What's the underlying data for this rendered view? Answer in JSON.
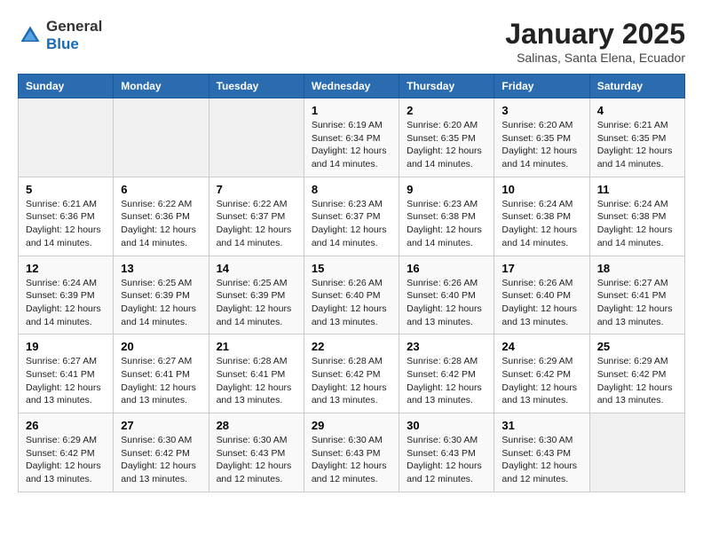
{
  "header": {
    "logo": {
      "general": "General",
      "blue": "Blue"
    },
    "title": "January 2025",
    "subtitle": "Salinas, Santa Elena, Ecuador"
  },
  "weekdays": [
    "Sunday",
    "Monday",
    "Tuesday",
    "Wednesday",
    "Thursday",
    "Friday",
    "Saturday"
  ],
  "weeks": [
    [
      {
        "day": null
      },
      {
        "day": null
      },
      {
        "day": null
      },
      {
        "day": 1,
        "sunrise": "6:19 AM",
        "sunset": "6:34 PM",
        "daylight": "12 hours and 14 minutes."
      },
      {
        "day": 2,
        "sunrise": "6:20 AM",
        "sunset": "6:35 PM",
        "daylight": "12 hours and 14 minutes."
      },
      {
        "day": 3,
        "sunrise": "6:20 AM",
        "sunset": "6:35 PM",
        "daylight": "12 hours and 14 minutes."
      },
      {
        "day": 4,
        "sunrise": "6:21 AM",
        "sunset": "6:35 PM",
        "daylight": "12 hours and 14 minutes."
      }
    ],
    [
      {
        "day": 5,
        "sunrise": "6:21 AM",
        "sunset": "6:36 PM",
        "daylight": "12 hours and 14 minutes."
      },
      {
        "day": 6,
        "sunrise": "6:22 AM",
        "sunset": "6:36 PM",
        "daylight": "12 hours and 14 minutes."
      },
      {
        "day": 7,
        "sunrise": "6:22 AM",
        "sunset": "6:37 PM",
        "daylight": "12 hours and 14 minutes."
      },
      {
        "day": 8,
        "sunrise": "6:23 AM",
        "sunset": "6:37 PM",
        "daylight": "12 hours and 14 minutes."
      },
      {
        "day": 9,
        "sunrise": "6:23 AM",
        "sunset": "6:38 PM",
        "daylight": "12 hours and 14 minutes."
      },
      {
        "day": 10,
        "sunrise": "6:24 AM",
        "sunset": "6:38 PM",
        "daylight": "12 hours and 14 minutes."
      },
      {
        "day": 11,
        "sunrise": "6:24 AM",
        "sunset": "6:38 PM",
        "daylight": "12 hours and 14 minutes."
      }
    ],
    [
      {
        "day": 12,
        "sunrise": "6:24 AM",
        "sunset": "6:39 PM",
        "daylight": "12 hours and 14 minutes."
      },
      {
        "day": 13,
        "sunrise": "6:25 AM",
        "sunset": "6:39 PM",
        "daylight": "12 hours and 14 minutes."
      },
      {
        "day": 14,
        "sunrise": "6:25 AM",
        "sunset": "6:39 PM",
        "daylight": "12 hours and 14 minutes."
      },
      {
        "day": 15,
        "sunrise": "6:26 AM",
        "sunset": "6:40 PM",
        "daylight": "12 hours and 13 minutes."
      },
      {
        "day": 16,
        "sunrise": "6:26 AM",
        "sunset": "6:40 PM",
        "daylight": "12 hours and 13 minutes."
      },
      {
        "day": 17,
        "sunrise": "6:26 AM",
        "sunset": "6:40 PM",
        "daylight": "12 hours and 13 minutes."
      },
      {
        "day": 18,
        "sunrise": "6:27 AM",
        "sunset": "6:41 PM",
        "daylight": "12 hours and 13 minutes."
      }
    ],
    [
      {
        "day": 19,
        "sunrise": "6:27 AM",
        "sunset": "6:41 PM",
        "daylight": "12 hours and 13 minutes."
      },
      {
        "day": 20,
        "sunrise": "6:27 AM",
        "sunset": "6:41 PM",
        "daylight": "12 hours and 13 minutes."
      },
      {
        "day": 21,
        "sunrise": "6:28 AM",
        "sunset": "6:41 PM",
        "daylight": "12 hours and 13 minutes."
      },
      {
        "day": 22,
        "sunrise": "6:28 AM",
        "sunset": "6:42 PM",
        "daylight": "12 hours and 13 minutes."
      },
      {
        "day": 23,
        "sunrise": "6:28 AM",
        "sunset": "6:42 PM",
        "daylight": "12 hours and 13 minutes."
      },
      {
        "day": 24,
        "sunrise": "6:29 AM",
        "sunset": "6:42 PM",
        "daylight": "12 hours and 13 minutes."
      },
      {
        "day": 25,
        "sunrise": "6:29 AM",
        "sunset": "6:42 PM",
        "daylight": "12 hours and 13 minutes."
      }
    ],
    [
      {
        "day": 26,
        "sunrise": "6:29 AM",
        "sunset": "6:42 PM",
        "daylight": "12 hours and 13 minutes."
      },
      {
        "day": 27,
        "sunrise": "6:30 AM",
        "sunset": "6:42 PM",
        "daylight": "12 hours and 13 minutes."
      },
      {
        "day": 28,
        "sunrise": "6:30 AM",
        "sunset": "6:43 PM",
        "daylight": "12 hours and 12 minutes."
      },
      {
        "day": 29,
        "sunrise": "6:30 AM",
        "sunset": "6:43 PM",
        "daylight": "12 hours and 12 minutes."
      },
      {
        "day": 30,
        "sunrise": "6:30 AM",
        "sunset": "6:43 PM",
        "daylight": "12 hours and 12 minutes."
      },
      {
        "day": 31,
        "sunrise": "6:30 AM",
        "sunset": "6:43 PM",
        "daylight": "12 hours and 12 minutes."
      },
      {
        "day": null
      }
    ]
  ],
  "labels": {
    "sunrise": "Sunrise:",
    "sunset": "Sunset:",
    "daylight": "Daylight:"
  }
}
